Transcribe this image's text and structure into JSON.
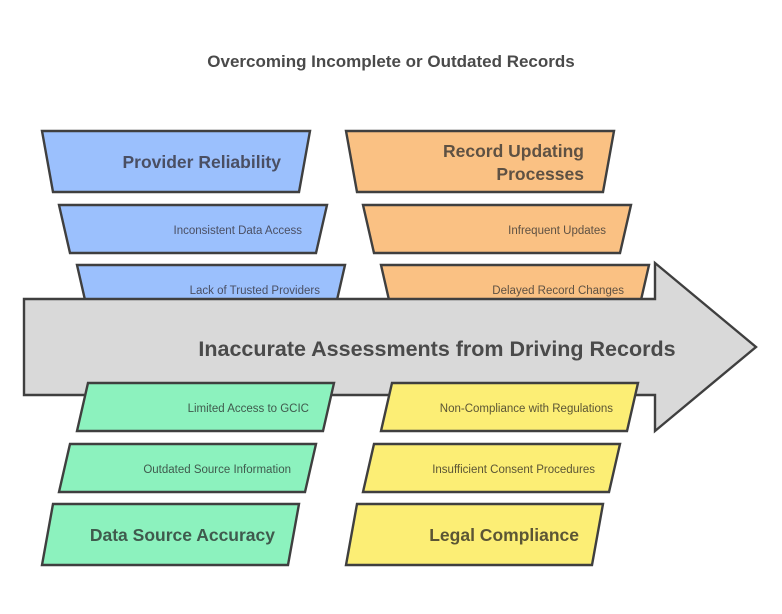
{
  "diagram": {
    "title": "Overcoming Incomplete or Outdated Records",
    "type": "fishbone",
    "spine": {
      "label": "Inaccurate Assessments from Driving Records",
      "fill": "#d9d9d9",
      "stroke": "#3f3f3f"
    },
    "branches": [
      {
        "id": "provider-reliability",
        "position": "top-left",
        "category": "Provider Reliability",
        "fill": "#9bc0fd",
        "text_color": "#4a4f63",
        "causes": [
          "Inconsistent Data Access",
          "Lack of Trusted Providers"
        ]
      },
      {
        "id": "record-updating-processes",
        "position": "top-right",
        "category": "Record Updating Processes",
        "category_line1": "Record Updating",
        "category_line2": "Processes",
        "fill": "#fac183",
        "text_color": "#5e5143",
        "causes": [
          "Infrequent Updates",
          "Delayed Record Changes"
        ]
      },
      {
        "id": "data-source-accuracy",
        "position": "bottom-left",
        "category": "Data Source Accuracy",
        "fill": "#8cf2be",
        "text_color": "#3f5a4d",
        "causes": [
          "Limited Access to GCIC",
          "Outdated Source Information"
        ]
      },
      {
        "id": "legal-compliance",
        "position": "bottom-right",
        "category": "Legal Compliance",
        "fill": "#fcee75",
        "text_color": "#5b5535",
        "causes": [
          "Non-Compliance with Regulations",
          "Insufficient Consent Procedures"
        ]
      }
    ]
  }
}
